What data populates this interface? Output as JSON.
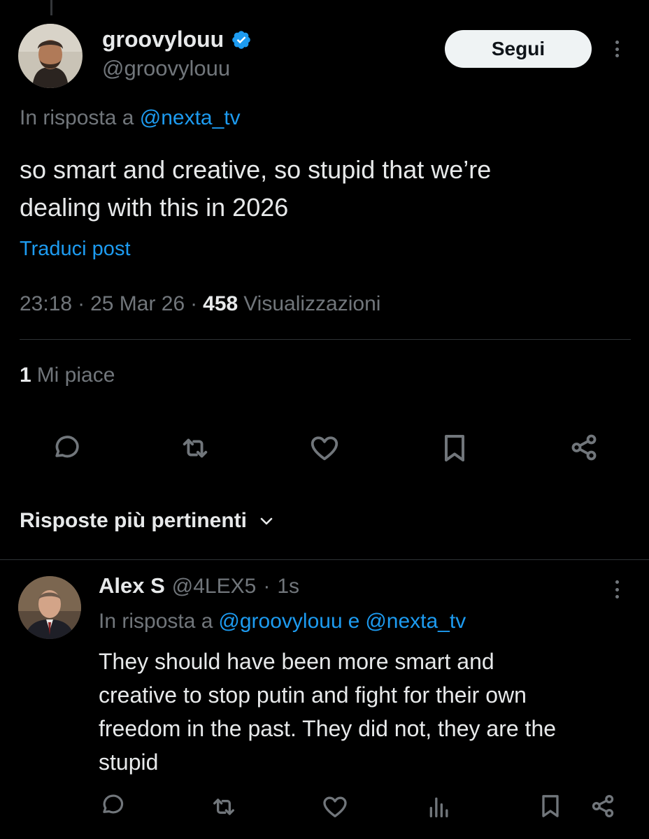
{
  "tweet": {
    "author_name": "groovylouu",
    "author_handle": "@groovylouu",
    "follow_label": "Segui",
    "reply_prefix": "In risposta a",
    "reply_to": "@nexta_tv",
    "text_line1": "so smart and creative, so stupid that we’re",
    "text_line2": "dealing with this in 2026",
    "translate_label": "Traduci post",
    "time": "23:18",
    "sep": "·",
    "date": "25 Mar 26",
    "views_count": "458",
    "views_label": "Visualizzazioni",
    "likes_count": "1",
    "likes_label": "Mi piace"
  },
  "replies_section": {
    "sort_label": "Risposte più pertinenti"
  },
  "reply": {
    "author_name": "Alex S",
    "author_handle": "@4LEX5",
    "sep": "·",
    "time_ago": "1s",
    "reply_prefix": "In risposta a",
    "reply_to_1": "@groovylouu",
    "conj": "e",
    "reply_to_2": "@nexta_tv",
    "text_line1": "They should have been more smart and",
    "text_line2": "creative to stop putin and fight for their own",
    "text_line3": "freedom in the past. They did not, they are the",
    "text_line4": "stupid"
  },
  "colors": {
    "background": "#000000",
    "text_primary": "#e7e9ea",
    "text_secondary": "#71767b",
    "link": "#1d9bf0",
    "verified": "#1d9bf0",
    "divider": "#2f3336"
  },
  "icons": [
    "verified-badge-icon",
    "more-icon",
    "reply-icon",
    "retweet-icon",
    "like-icon",
    "bookmark-icon",
    "share-icon",
    "chevron-down-icon",
    "views-icon"
  ]
}
